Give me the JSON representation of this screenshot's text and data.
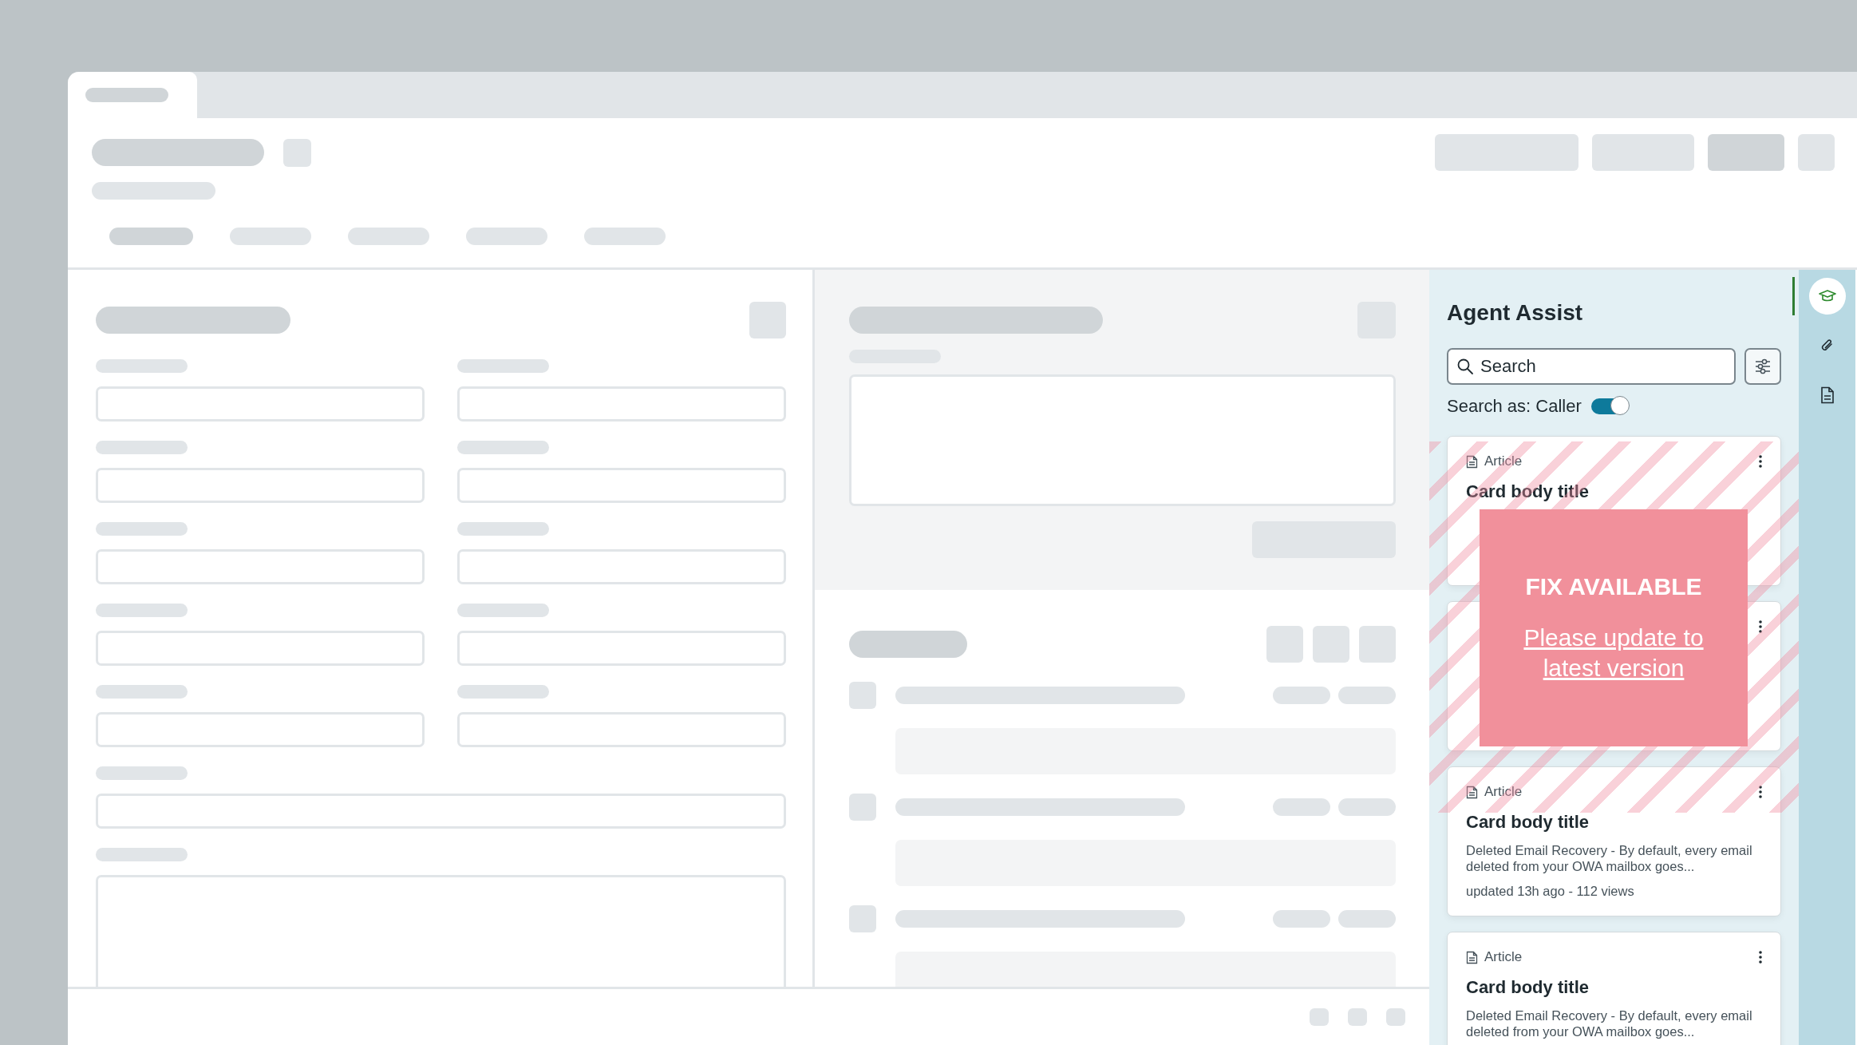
{
  "panel": {
    "title": "Agent Assist",
    "search": {
      "placeholder": "Search"
    },
    "search_as": {
      "label": "Search as: Caller",
      "on": true
    }
  },
  "cards": [
    {
      "kind": "article",
      "type": "Article",
      "title": "Card body title"
    },
    {
      "kind": "article"
    },
    {
      "kind": "article",
      "type": "Article",
      "title": "Card body title",
      "description": "Deleted Email Recovery - By default, every email deleted from your OWA mailbox goes...",
      "meta": "updated 13h ago - 112 views"
    },
    {
      "kind": "article",
      "type": "Article",
      "title": "Card body title",
      "description": "Deleted Email Recovery - By default, every email deleted from your OWA mailbox goes..."
    }
  ],
  "notice": {
    "heading": "FIX AVAILABLE",
    "link": "Please update to latest version"
  },
  "rail": [
    {
      "kind": "cap",
      "selected": true
    },
    {
      "kind": "clip",
      "selected": false
    },
    {
      "kind": "doc",
      "selected": false
    }
  ]
}
